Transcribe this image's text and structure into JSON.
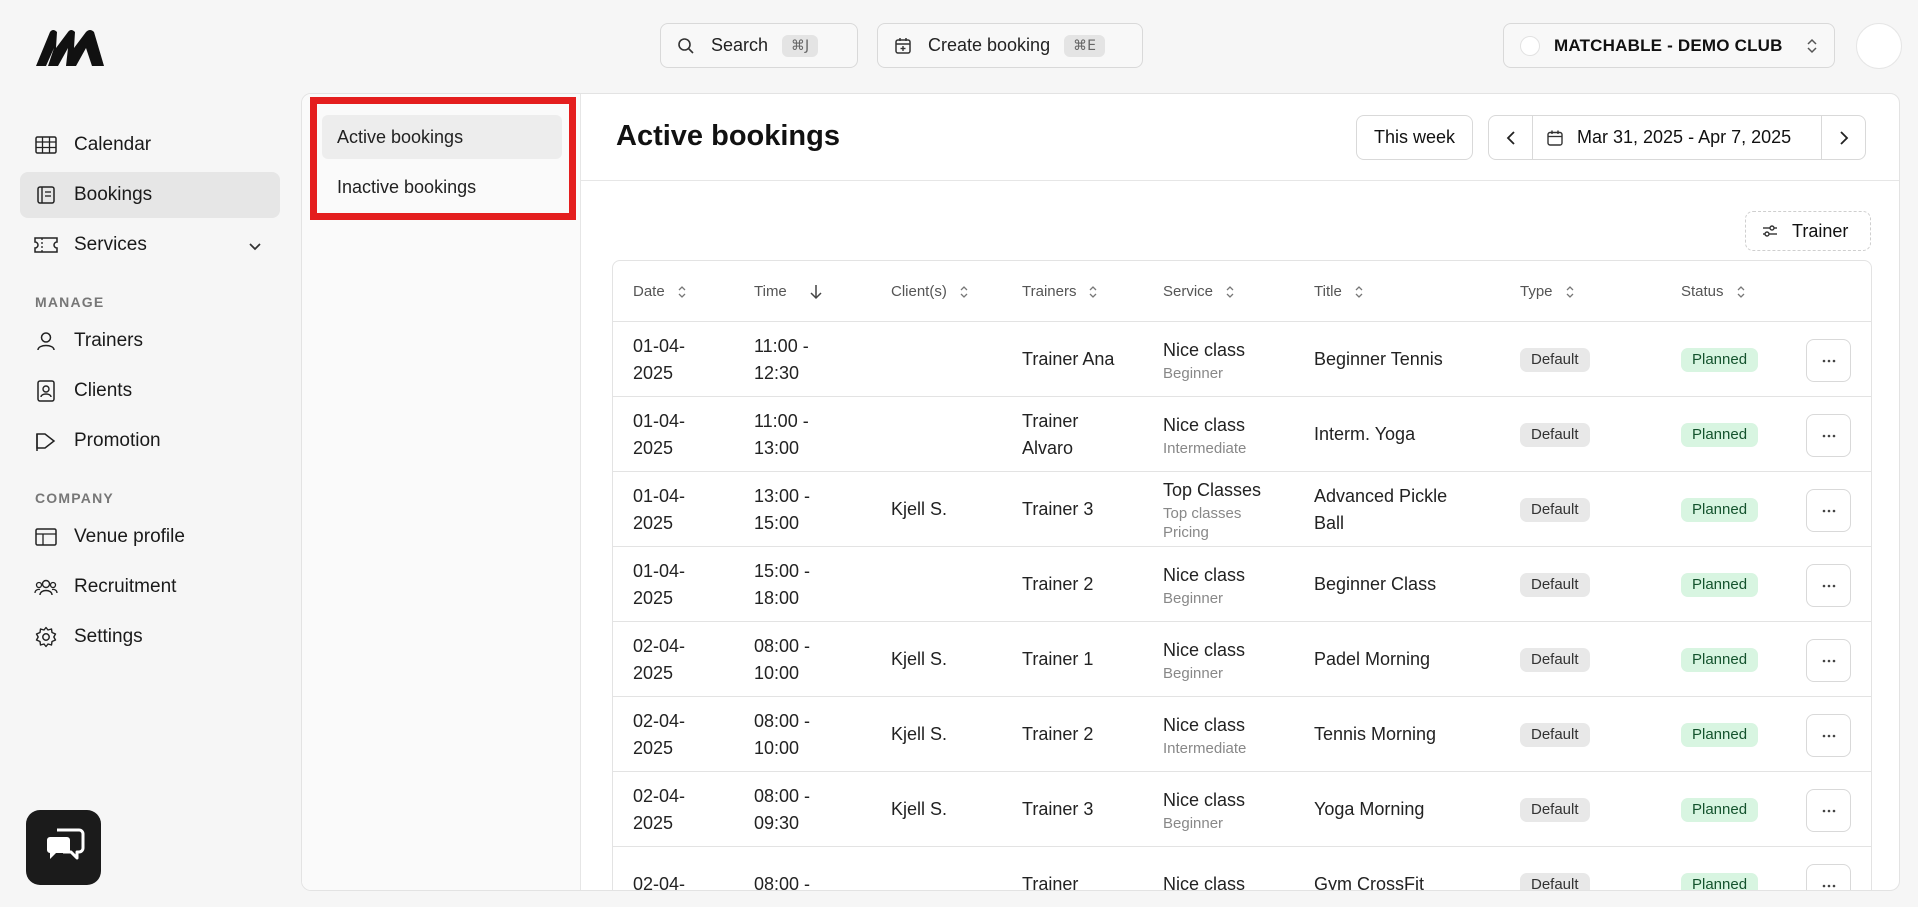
{
  "topbar": {
    "search_label": "Search",
    "search_shortcut": "⌘J",
    "create_label": "Create booking",
    "create_shortcut": "⌘E",
    "club_name": "MATCHABLE - DEMO CLUB"
  },
  "sidebar": {
    "items": [
      {
        "label": "Calendar",
        "icon": "calendar-grid-icon"
      },
      {
        "label": "Bookings",
        "icon": "bookings-icon",
        "active": true
      },
      {
        "label": "Services",
        "icon": "ticket-icon",
        "expandable": true
      }
    ],
    "manage_label": "MANAGE",
    "manage_items": [
      {
        "label": "Trainers",
        "icon": "user-icon"
      },
      {
        "label": "Clients",
        "icon": "contact-card-icon"
      },
      {
        "label": "Promotion",
        "icon": "megaphone-icon"
      }
    ],
    "company_label": "COMPANY",
    "company_items": [
      {
        "label": "Venue profile",
        "icon": "layout-icon"
      },
      {
        "label": "Recruitment",
        "icon": "users-icon"
      },
      {
        "label": "Settings",
        "icon": "gear-icon"
      }
    ]
  },
  "subnav": {
    "active": "Active bookings",
    "inactive": "Inactive bookings"
  },
  "content": {
    "title": "Active bookings",
    "this_week": "This week",
    "date_range": "Mar 31, 2025 - Apr 7, 2025",
    "trainer_filter": "Trainer"
  },
  "table": {
    "headers": [
      "Date",
      "Time",
      "Client(s)",
      "Trainers",
      "Service",
      "Title",
      "Type",
      "Status"
    ],
    "rows": [
      {
        "date": [
          "01-04-",
          "2025"
        ],
        "time": [
          "11:00 -",
          "12:30"
        ],
        "client": "",
        "trainer": [
          "Trainer Ana"
        ],
        "service": "Nice class",
        "service_sub": [
          "Beginner"
        ],
        "title": [
          "Beginner Tennis"
        ],
        "type": "Default",
        "status": "Planned"
      },
      {
        "date": [
          "01-04-",
          "2025"
        ],
        "time": [
          "11:00 -",
          "13:00"
        ],
        "client": "",
        "trainer": [
          "Trainer",
          "Alvaro"
        ],
        "service": "Nice class",
        "service_sub": [
          "Intermediate"
        ],
        "title": [
          "Interm. Yoga"
        ],
        "type": "Default",
        "status": "Planned"
      },
      {
        "date": [
          "01-04-",
          "2025"
        ],
        "time": [
          "13:00 -",
          "15:00"
        ],
        "client": "Kjell S.",
        "trainer": [
          "Trainer 3"
        ],
        "service": "Top Classes",
        "service_sub": [
          "Top classes",
          "Pricing"
        ],
        "title": [
          "Advanced Pickle",
          "Ball"
        ],
        "type": "Default",
        "status": "Planned"
      },
      {
        "date": [
          "01-04-",
          "2025"
        ],
        "time": [
          "15:00 -",
          "18:00"
        ],
        "client": "",
        "trainer": [
          "Trainer 2"
        ],
        "service": "Nice class",
        "service_sub": [
          "Beginner"
        ],
        "title": [
          "Beginner Class"
        ],
        "type": "Default",
        "status": "Planned"
      },
      {
        "date": [
          "02-04-",
          "2025"
        ],
        "time": [
          "08:00 -",
          "10:00"
        ],
        "client": "Kjell S.",
        "trainer": [
          "Trainer 1"
        ],
        "service": "Nice class",
        "service_sub": [
          "Beginner"
        ],
        "title": [
          "Padel Morning"
        ],
        "type": "Default",
        "status": "Planned"
      },
      {
        "date": [
          "02-04-",
          "2025"
        ],
        "time": [
          "08:00 -",
          "10:00"
        ],
        "client": "Kjell S.",
        "trainer": [
          "Trainer 2"
        ],
        "service": "Nice class",
        "service_sub": [
          "Intermediate"
        ],
        "title": [
          "Tennis Morning"
        ],
        "type": "Default",
        "status": "Planned"
      },
      {
        "date": [
          "02-04-",
          "2025"
        ],
        "time": [
          "08:00 -",
          "09:30"
        ],
        "client": "Kjell S.",
        "trainer": [
          "Trainer 3"
        ],
        "service": "Nice class",
        "service_sub": [
          "Beginner"
        ],
        "title": [
          "Yoga Morning"
        ],
        "type": "Default",
        "status": "Planned"
      },
      {
        "date": [
          "02-04-",
          ""
        ],
        "time": [
          "08:00 -",
          ""
        ],
        "client": "",
        "trainer": [
          "Trainer",
          ""
        ],
        "service": "Nice class",
        "service_sub": [],
        "title": [
          "Gym CrossFit"
        ],
        "type": "Default",
        "status": "Planned"
      }
    ]
  },
  "colors": {
    "highlight_frame": "#e41e1e",
    "planned_badge": "#d8f5e1",
    "default_badge": "#e8e8e8"
  }
}
